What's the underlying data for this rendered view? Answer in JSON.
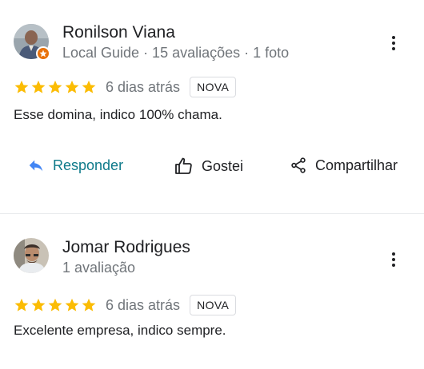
{
  "reviews": [
    {
      "name": "Ronilson Viana",
      "meta": "Local Guide · 15 avaliações · 1 foto",
      "rating": 5,
      "date": "6 dias atrás",
      "badge": "NOVA",
      "text": "Esse domina, indico 100% chama.",
      "actions": {
        "reply": "Responder",
        "like": "Gostei",
        "share": "Compartilhar"
      }
    },
    {
      "name": "Jomar Rodrigues",
      "meta": "1 avaliação",
      "rating": 5,
      "date": "6 dias atrás",
      "badge": "NOVA",
      "text": "Excelente empresa, indico sempre."
    }
  ],
  "colors": {
    "star": "#fbbc04",
    "reply_icon": "#4285f4",
    "reply_text": "#0e7a8a",
    "local_guide_badge": "#e8710a",
    "secondary_text": "#70757a"
  }
}
